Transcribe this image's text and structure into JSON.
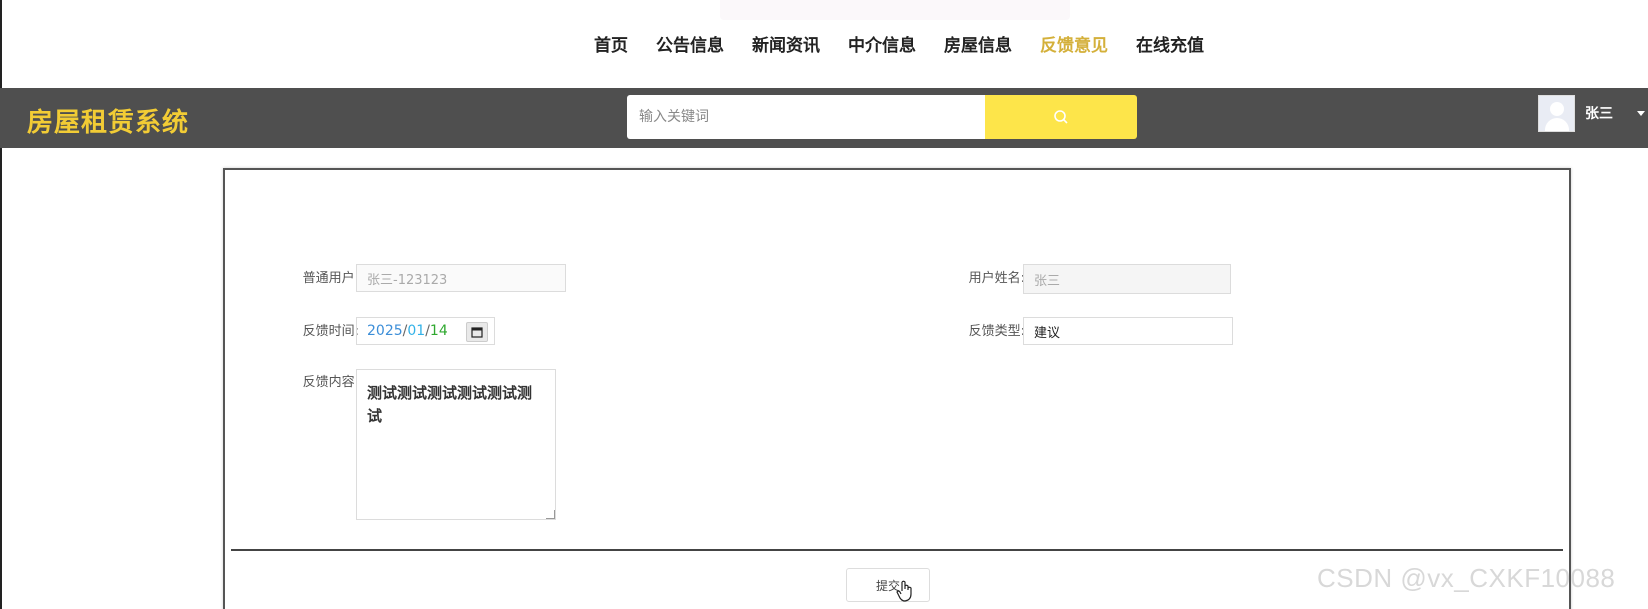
{
  "nav": {
    "items": [
      {
        "label": "首页",
        "active": false
      },
      {
        "label": "公告信息",
        "active": false
      },
      {
        "label": "新闻资讯",
        "active": false
      },
      {
        "label": "中介信息",
        "active": false
      },
      {
        "label": "房屋信息",
        "active": false
      },
      {
        "label": "反馈意见",
        "active": true
      },
      {
        "label": "在线充值",
        "active": false
      }
    ]
  },
  "header": {
    "logo": "房屋租赁系统",
    "search_placeholder": "输入关键词",
    "search_icon": "search-icon",
    "user_name": "张三"
  },
  "form": {
    "user_label": "普通用户:",
    "user_value": "张三-123123",
    "username_label": "用户姓名:",
    "username_value": "张三",
    "time_label": "反馈时间:",
    "time_year": "2025",
    "time_month": "01",
    "time_day": "14",
    "time_sep": "/",
    "type_label": "反馈类型:",
    "type_value": "建议",
    "content_label": "反馈内容:",
    "content_value": "测试测试测试测试测试测试",
    "submit_label": "提交"
  },
  "watermark": "CSDN @vx_CXKF10088",
  "colors": {
    "header_bg": "#4f4f4f",
    "logo": "#f2cc35",
    "search_button": "#fde54a",
    "nav_active": "#d4b03a"
  }
}
